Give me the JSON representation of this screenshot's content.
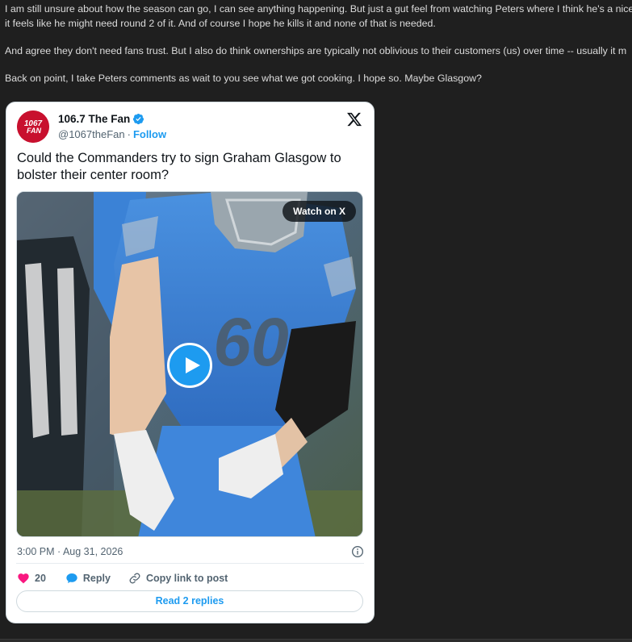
{
  "post": {
    "paragraphs": [
      "I am still unsure about how the season can go, I can see anything happening. But just a gut feel from watching Peters where I think he's a nice",
      "it feels like he might need round 2 of it. And of course I hope he kills it and none of that is needed.",
      "And agree they don't need fans trust. But I also do think ownerships are typically not oblivious to their customers (us) over time -- usually it m",
      "Back on point, I take Peters comments as wait to you see what we got cooking. I hope so. Maybe Glasgow?"
    ]
  },
  "embed": {
    "account_name": "106.7 The Fan",
    "handle": "@1067theFan",
    "separator": "·",
    "follow_label": "Follow",
    "avatar_text_top": "1067",
    "avatar_text_bottom": "FAN",
    "tweet_text": "Could the Commanders try to sign Graham Glasgow to bolster their center room?",
    "watch_label": "Watch on X",
    "jersey_number": "60",
    "timestamp": "3:00 PM · Aug 31, 2026",
    "like_count": "20",
    "reply_label": "Reply",
    "copy_link_label": "Copy link to post",
    "read_replies_label": "Read 2 replies"
  },
  "colors": {
    "page_background": "#1f1f1f",
    "accent_blue": "#1d9bf0",
    "like_pink": "#f91880",
    "brand_red": "#c8102e",
    "lions_blue": "#3b82d6"
  },
  "icons": {
    "verified": "verified-badge-icon",
    "x_logo": "x-logo-icon",
    "play": "play-icon",
    "info": "info-icon",
    "like": "heart-icon",
    "reply": "speech-bubble-icon",
    "copy_link": "link-icon"
  }
}
